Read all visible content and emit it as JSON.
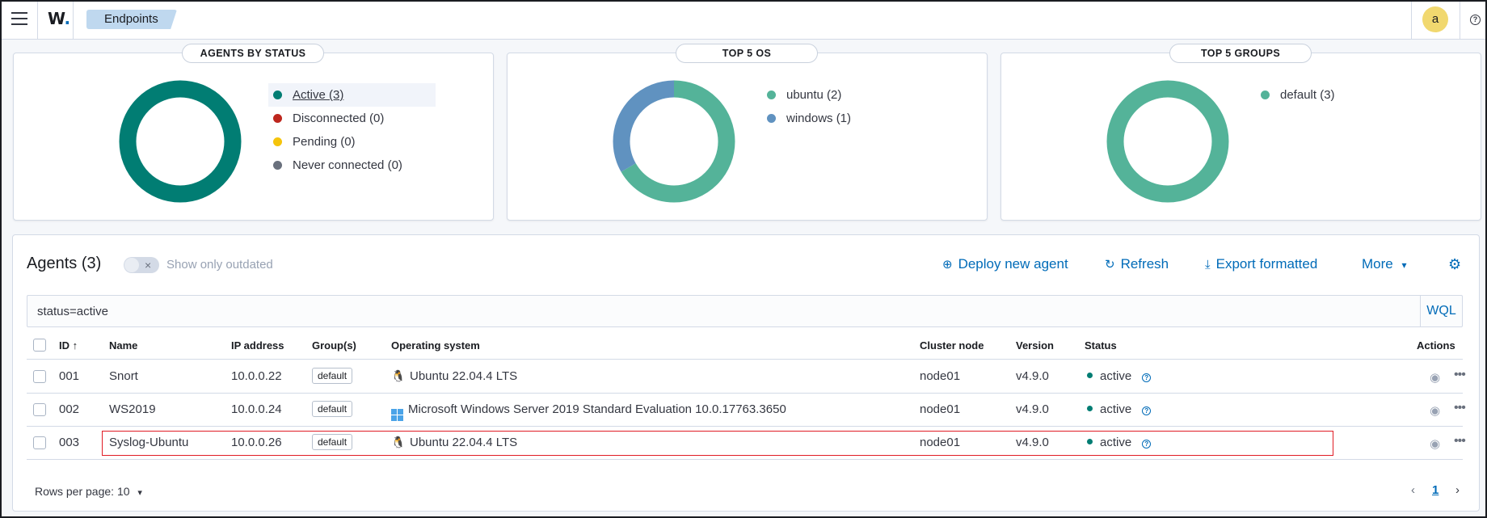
{
  "header": {
    "logo": "W.",
    "breadcrumb": "Endpoints",
    "avatar_letter": "a",
    "help_glyph": "?"
  },
  "panels": {
    "status": {
      "title": "AGENTS BY STATUS",
      "items": [
        {
          "label": "Active (3)",
          "color": "#017d73"
        },
        {
          "label": "Disconnected (0)",
          "color": "#bd271e"
        },
        {
          "label": "Pending (0)",
          "color": "#f5c40c"
        },
        {
          "label": "Never connected (0)",
          "color": "#69707d"
        }
      ],
      "chart_values": [
        3,
        0,
        0,
        0
      ]
    },
    "os": {
      "title": "TOP 5 OS",
      "items": [
        {
          "label": "ubuntu (2)",
          "color": "#54b399"
        },
        {
          "label": "windows (1)",
          "color": "#6092c0"
        }
      ],
      "chart_values": [
        2,
        1
      ]
    },
    "groups": {
      "title": "TOP 5 GROUPS",
      "items": [
        {
          "label": "default (3)",
          "color": "#54b399"
        }
      ],
      "chart_values": [
        3
      ]
    }
  },
  "agents": {
    "title": "Agents (3)",
    "toggle_label": "Show only outdated",
    "toggle_x": "×",
    "deploy_label": "Deploy new agent",
    "refresh_label": "Refresh",
    "export_label": "Export formatted",
    "more_label": "More",
    "search_value": "status=active",
    "search_mode": "WQL",
    "columns": {
      "id": "ID ↑",
      "name": "Name",
      "ip": "IP address",
      "groups": "Group(s)",
      "os": "Operating system",
      "node": "Cluster node",
      "version": "Version",
      "status": "Status",
      "actions": "Actions"
    },
    "rows": [
      {
        "id": "001",
        "name": "Snort",
        "ip": "10.0.0.22",
        "group": "default",
        "os_icon": "linux-icon",
        "os": "Ubuntu 22.04.4 LTS",
        "node": "node01",
        "version": "v4.9.0",
        "status": "active"
      },
      {
        "id": "002",
        "name": "WS2019",
        "ip": "10.0.0.24",
        "group": "default",
        "os_icon": "windows-icon",
        "os": "Microsoft Windows Server 2019 Standard Evaluation 10.0.17763.3650",
        "node": "node01",
        "version": "v4.9.0",
        "status": "active"
      },
      {
        "id": "003",
        "name": "Syslog-Ubuntu",
        "ip": "10.0.0.26",
        "group": "default",
        "os_icon": "linux-icon",
        "os": "Ubuntu 22.04.4 LTS",
        "node": "node01",
        "version": "v4.9.0",
        "status": "active"
      }
    ],
    "rows_per_page": "Rows per page: 10",
    "current_page": "1"
  }
}
